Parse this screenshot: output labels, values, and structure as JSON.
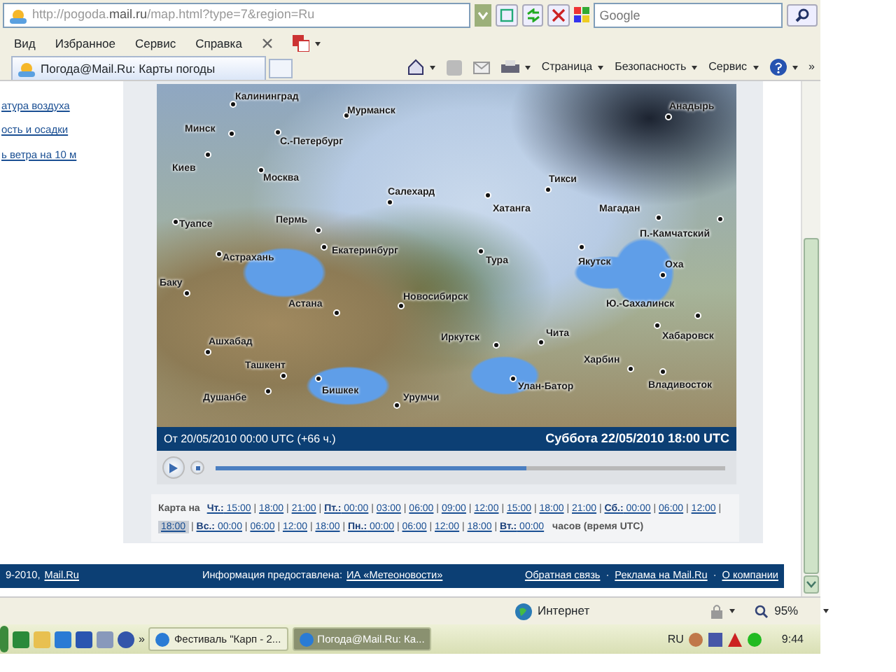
{
  "address_bar": {
    "url": "http://pogoda.**mail.ru**/map.html?type=7&region=Ru"
  },
  "search_box": {
    "placeholder": "Google"
  },
  "menu_bar": [
    "Вид",
    "Избранное",
    "Сервис",
    "Справка"
  ],
  "tabs": [
    {
      "title": "Погода@Mail.Ru: Карты погоды",
      "selected": true
    }
  ],
  "command_menus": [
    "Страница",
    "Безопасность",
    "Сервис"
  ],
  "command_overflow": "»",
  "sidebar_links": [
    "атура воздуха",
    "ость и осадки",
    "ь ветра на 10 м"
  ],
  "map": {
    "cities": [
      "Калининград",
      "Мурманск",
      "Анадырь",
      "Минск",
      "С.-Петербург",
      "Киев",
      "Москва",
      "Тикси",
      "Салехард",
      "Хатанга",
      "Магадан",
      "Туапсе",
      "Пермь",
      "П.-Камчатский",
      "Астрахань",
      "Екатеринбург",
      "Тура",
      "Якутск",
      "Оха",
      "Баку",
      "Астана",
      "Новосибирск",
      "Ю.-Сахалинск",
      "Ашхабад",
      "Иркутск",
      "Чита",
      "Хабаровск",
      "Ташкент",
      "Харбин",
      "Душанбе",
      "Бишкек",
      "Урумчи",
      "Улан-Батор",
      "Владивосток"
    ]
  },
  "caption": {
    "range": "От 20/05/2010 00:00 UTC (+66 ч.)",
    "current": "Суббота  22/05/2010 18:00 UTC"
  },
  "player": {
    "level": 0.61
  },
  "time_selector": {
    "label": "Карта на",
    "separator": "|",
    "suffix": "часов (время UTC)",
    "slots": [
      {
        "text": "**Чт.:** 15:00",
        "selected": false
      },
      {
        "text": "18:00",
        "selected": false
      },
      {
        "text": "21:00",
        "selected": false
      },
      {
        "text": "**Пт.:** 00:00",
        "selected": false
      },
      {
        "text": "03:00",
        "selected": false
      },
      {
        "text": "06:00",
        "selected": false
      },
      {
        "text": "09:00",
        "selected": false
      },
      {
        "text": "12:00",
        "selected": false
      },
      {
        "text": "15:00",
        "selected": false
      },
      {
        "text": "18:00",
        "selected": false
      },
      {
        "text": "21:00",
        "selected": false
      },
      {
        "text": "**Сб.:** 00:00",
        "selected": false
      },
      {
        "text": "06:00",
        "selected": false
      },
      {
        "text": "12:00",
        "selected": false
      },
      {
        "text": "18:00",
        "selected": true
      },
      {
        "text": "**Вс.:** 00:00",
        "selected": false
      },
      {
        "text": "06:00",
        "selected": false
      },
      {
        "text": "12:00",
        "selected": false
      },
      {
        "text": "18:00",
        "selected": false
      },
      {
        "text": "**Пн.:** 00:00",
        "selected": false
      },
      {
        "text": "06:00",
        "selected": false
      },
      {
        "text": "12:00",
        "selected": false
      },
      {
        "text": "18:00",
        "selected": false
      },
      {
        "text": "**Вт.:** 00:00",
        "selected": false
      }
    ]
  },
  "footer": {
    "copyright": "9-2010,",
    "copyright_link": "Mail.Ru",
    "info": "Информация предоставлена:",
    "info_link": "ИА «Метеоновости»",
    "separator": "·",
    "links": [
      "Обратная связь",
      "Реклама на Mail.Ru",
      "О компании"
    ]
  },
  "status_bar": {
    "zone": "Интернет",
    "zoom": "95%"
  },
  "taskbar": {
    "overflow": "»",
    "tasks": [
      {
        "title": "Фестиваль \"Карп - 2...",
        "selected": false
      },
      {
        "title": "Погода@Mail.Ru: Ка...",
        "selected": true
      }
    ],
    "language": "RU",
    "clock": "9:44"
  }
}
